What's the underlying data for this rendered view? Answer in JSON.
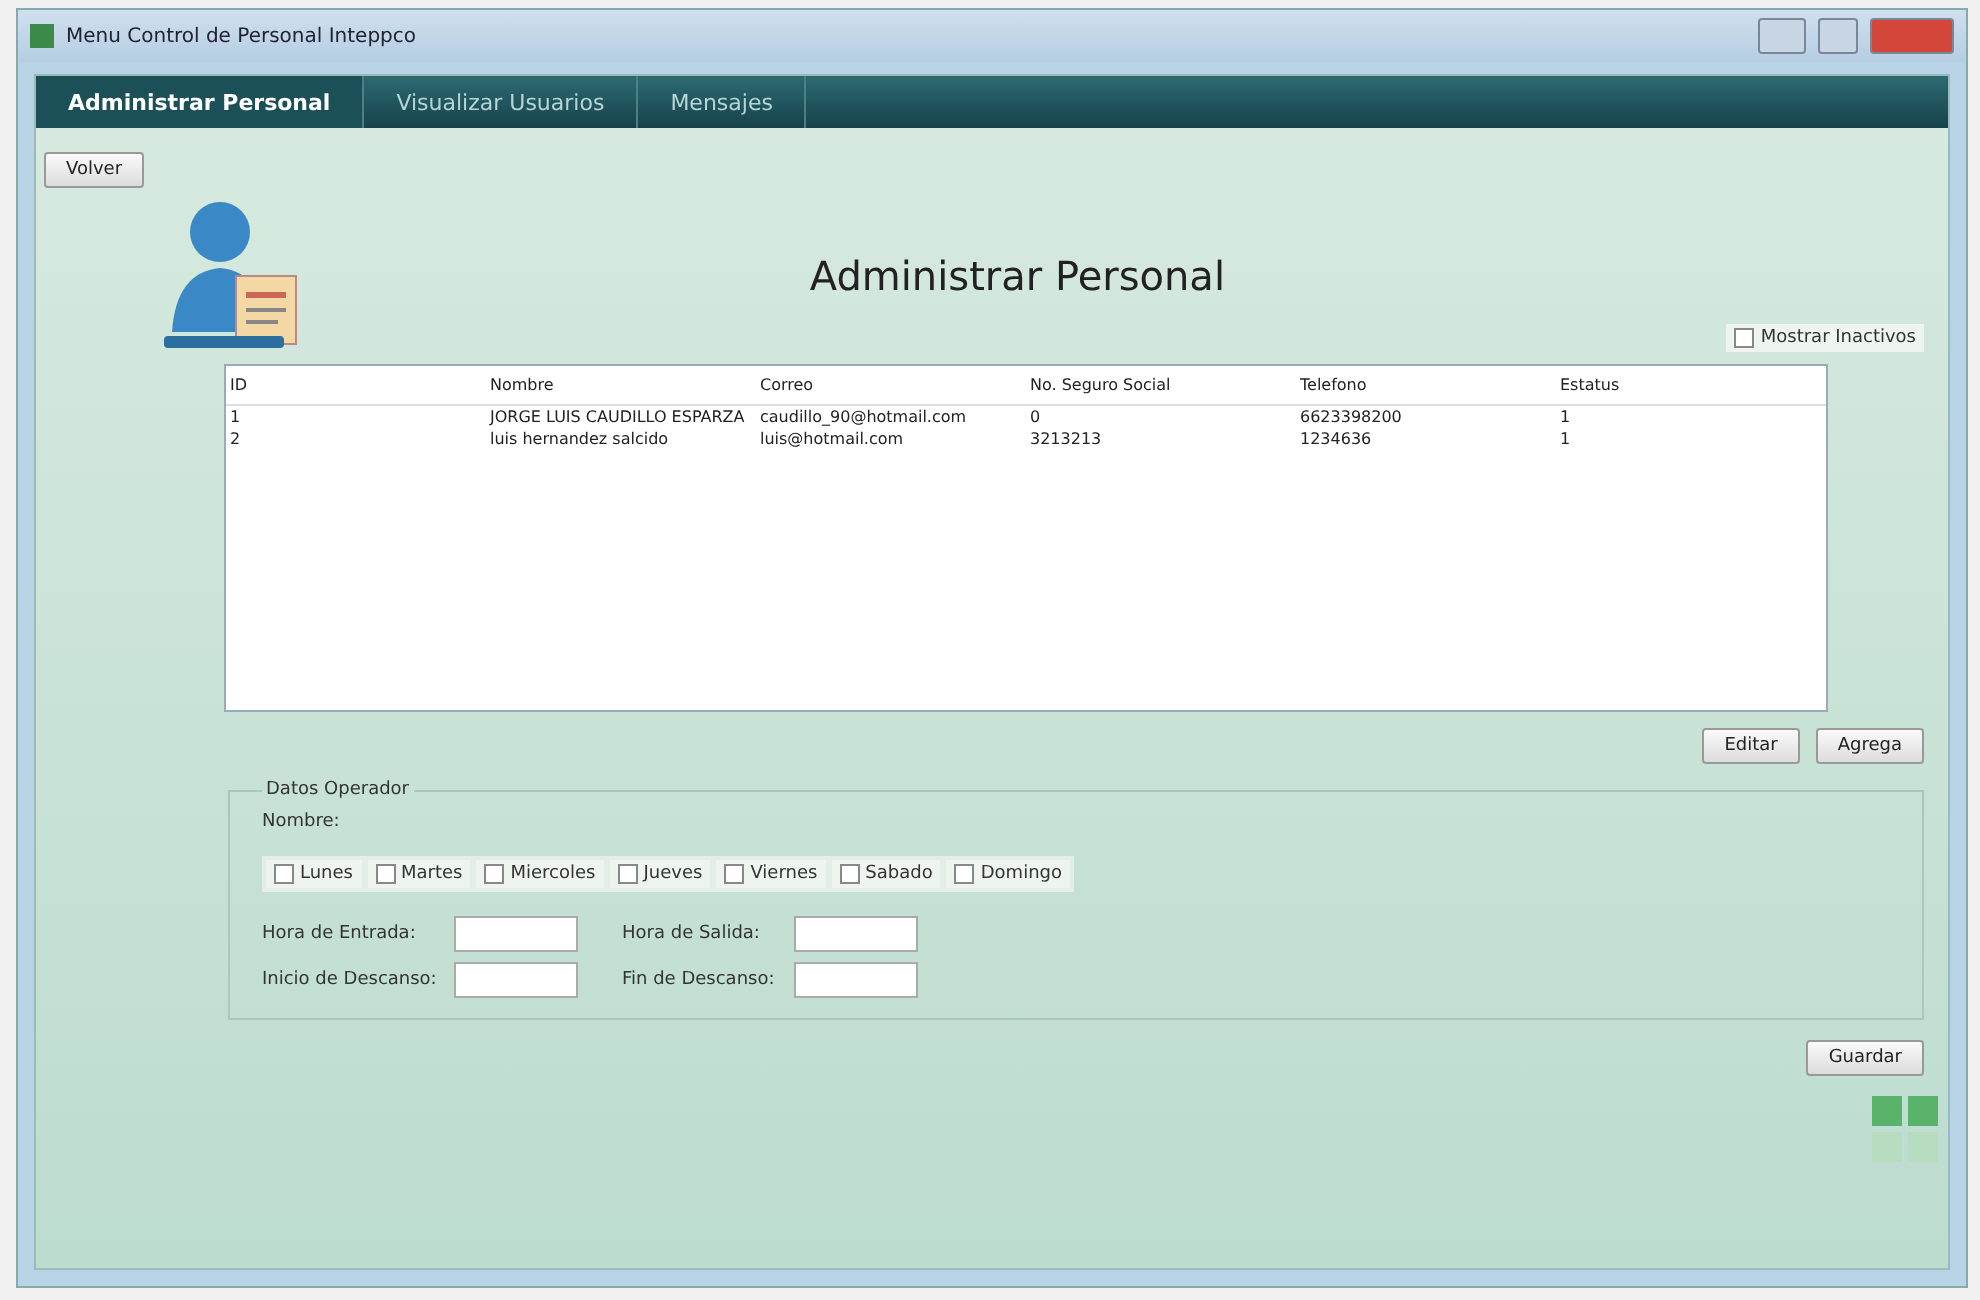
{
  "window": {
    "title": "Menu Control de Personal Inteppco"
  },
  "tabs": [
    {
      "label": "Administrar Personal",
      "selected": true
    },
    {
      "label": "Visualizar Usuarios",
      "selected": false
    },
    {
      "label": "Mensajes",
      "selected": false
    }
  ],
  "back_button": "Volver",
  "heading": "Administrar Personal",
  "show_inactive": {
    "label": "Mostrar Inactivos",
    "checked": false
  },
  "table": {
    "columns": [
      "ID",
      "Nombre",
      "Correo",
      "No. Seguro Social",
      "Telefono",
      "Estatus"
    ],
    "rows": [
      [
        "1",
        "JORGE LUIS CAUDILLO ESPARZA",
        "caudillo_90@hotmail.com",
        "0",
        "6623398200",
        "1"
      ],
      [
        "2",
        "luis hernandez salcido",
        "luis@hotmail.com",
        "3213213",
        "1234636",
        "1"
      ]
    ]
  },
  "table_buttons": [
    "Editar",
    "Agrega"
  ],
  "form": {
    "title": "Datos Operador",
    "name_label": "Nombre:",
    "days": [
      {
        "label": "Lunes",
        "checked": false
      },
      {
        "label": "Martes",
        "checked": false
      },
      {
        "label": "Miercoles",
        "checked": false
      },
      {
        "label": "Jueves",
        "checked": false
      },
      {
        "label": "Viernes",
        "checked": false
      },
      {
        "label": "Sabado",
        "checked": false
      },
      {
        "label": "Domingo",
        "checked": false
      }
    ],
    "fields": [
      {
        "label": "Hora de Entrada:"
      },
      {
        "label": "Hora de Salida:"
      },
      {
        "label": "Inicio de Descanso:"
      },
      {
        "label": "Fin de Descanso:"
      }
    ]
  },
  "save_button": "Guardar"
}
